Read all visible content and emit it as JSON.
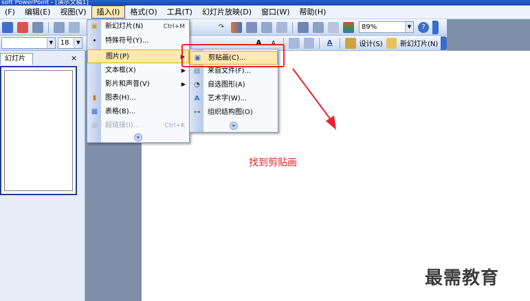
{
  "window": {
    "title": "soft PowerPoint - [演示文稿1]"
  },
  "menubar": {
    "items": [
      {
        "label": "(F)"
      },
      {
        "label": "编辑(E)"
      },
      {
        "label": "视图(V)"
      },
      {
        "label": "插入(I)",
        "active": true
      },
      {
        "label": "格式(O)"
      },
      {
        "label": "工具(T)"
      },
      {
        "label": "幻灯片放映(D)"
      },
      {
        "label": "窗口(W)"
      },
      {
        "label": "帮助(H)"
      }
    ]
  },
  "toolbar": {
    "zoom_value": "89%",
    "font_size_value": "18",
    "design_label": "设计(S)",
    "new_slide_label": "新幻灯片(N)"
  },
  "slides_pane": {
    "tab_label": "幻灯片",
    "close_glyph": "×"
  },
  "insert_menu": {
    "items": [
      {
        "label": "新幻灯片(N)",
        "shortcut": "Ctrl+M"
      },
      {
        "label": "特殊符号(Y)..."
      },
      {
        "label": "图片(P)",
        "has_submenu": true
      },
      {
        "label": "文本框(X)",
        "has_submenu": true
      },
      {
        "label": "影片和声音(V)",
        "has_submenu": true
      },
      {
        "label": "图表(H)..."
      },
      {
        "label": "表格(B)..."
      },
      {
        "label": "超链接(I)...",
        "shortcut": "Ctrl+K",
        "disabled": true
      }
    ],
    "expand_glyph": "»"
  },
  "picture_submenu": {
    "items": [
      {
        "label": "剪贴画(C)..."
      },
      {
        "label": "来自文件(F)..."
      },
      {
        "label": "自选图形(A)"
      },
      {
        "label": "艺术字(W)..."
      },
      {
        "label": "组织结构图(O)"
      }
    ],
    "expand_glyph": "»"
  },
  "annotation": {
    "text": "找到剪贴画",
    "color": "#e9232b"
  },
  "watermark": {
    "text": "最需教育"
  },
  "colors": {
    "menu_hover": "#fde9ae",
    "accent": "#2e57a7"
  }
}
